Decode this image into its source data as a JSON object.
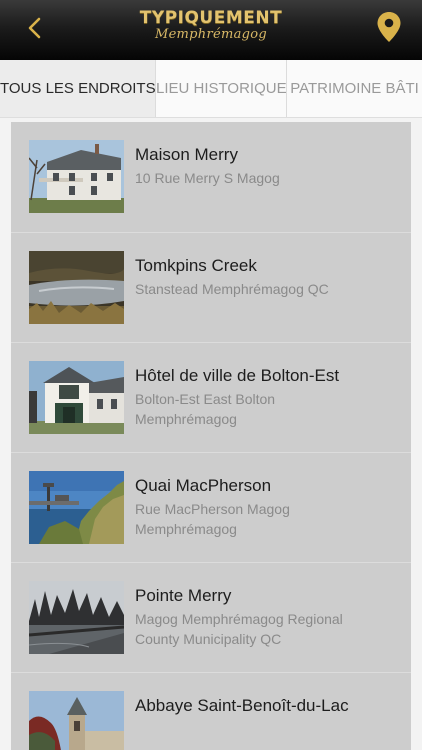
{
  "header": {
    "logo_title": "TYPIQUEMENT",
    "logo_subtitle": "Memphrémagog",
    "back_icon": "chevron-left-icon",
    "location_icon": "map-pin-icon",
    "accent_color": "#d9b24a"
  },
  "tabs": [
    {
      "label": "TOUS LES ENDROITS",
      "active": true
    },
    {
      "label": "LIEU HISTORIQUE",
      "active": false
    },
    {
      "label": "PATRIMOINE BÂTI",
      "active": false
    }
  ],
  "places": [
    {
      "title": "Maison Merry",
      "address": "10 Rue Merry S Magog"
    },
    {
      "title": "Tomkpins Creek",
      "address": "Stanstead Memphrémagog QC"
    },
    {
      "title": "Hôtel de ville de Bolton-Est",
      "address": "Bolton-Est East Bolton Memphrémagog"
    },
    {
      "title": "Quai MacPherson",
      "address": "Rue MacPherson Magog Memphrémagog"
    },
    {
      "title": "Pointe Merry",
      "address": "Magog Memphrémagog Regional County Municipality QC"
    },
    {
      "title": "Abbaye Saint-Benoît-du-Lac",
      "address": ""
    }
  ]
}
